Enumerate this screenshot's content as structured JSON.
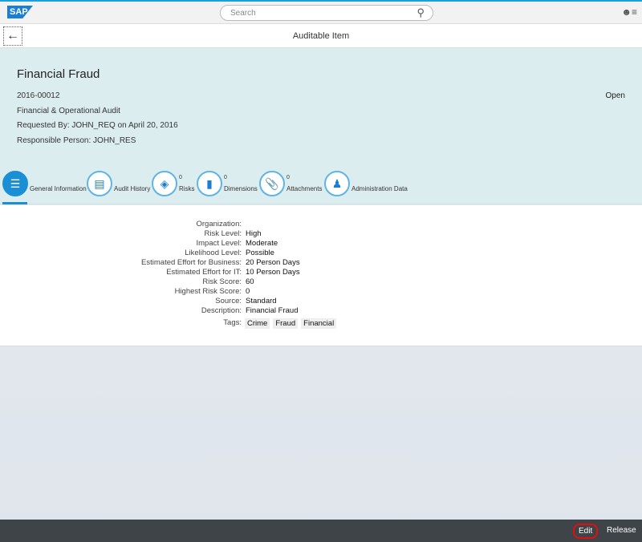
{
  "shell": {
    "logo": "SAP",
    "search_placeholder": "Search"
  },
  "nav": {
    "title": "Auditable Item"
  },
  "header": {
    "title": "Financial Fraud",
    "id": "2016-00012",
    "type": "Financial & Operational Audit",
    "requested": "Requested By: JOHN_REQ on April 20, 2016",
    "responsible": "Responsible Person: JOHN_RES",
    "status": "Open"
  },
  "tabs": [
    {
      "label": "General Information"
    },
    {
      "label": "Audit History"
    },
    {
      "label": "Risks",
      "count": "0"
    },
    {
      "label": "Dimensions",
      "count": "0"
    },
    {
      "label": "Attachments",
      "count": "0"
    },
    {
      "label": "Administration Data"
    }
  ],
  "fields": [
    {
      "label": "Organization:",
      "value": ""
    },
    {
      "label": "Risk Level:",
      "value": "High"
    },
    {
      "label": "Impact Level:",
      "value": "Moderate"
    },
    {
      "label": "Likelihood Level:",
      "value": "Possible"
    },
    {
      "label": "Estimated Effort for Business:",
      "value": "20 Person Days"
    },
    {
      "label": "Estimated Effort for IT:",
      "value": "10 Person Days"
    },
    {
      "label": "Risk Score:",
      "value": "60"
    },
    {
      "label": "Highest Risk Score:",
      "value": "0"
    },
    {
      "label": "Source:",
      "value": "Standard"
    },
    {
      "label": "Description:",
      "value": "Financial Fraud"
    }
  ],
  "tags": {
    "label": "Tags:",
    "items": [
      "Crime",
      "Fraud",
      "Financial"
    ]
  },
  "footer": {
    "edit": "Edit",
    "release": "Release"
  }
}
